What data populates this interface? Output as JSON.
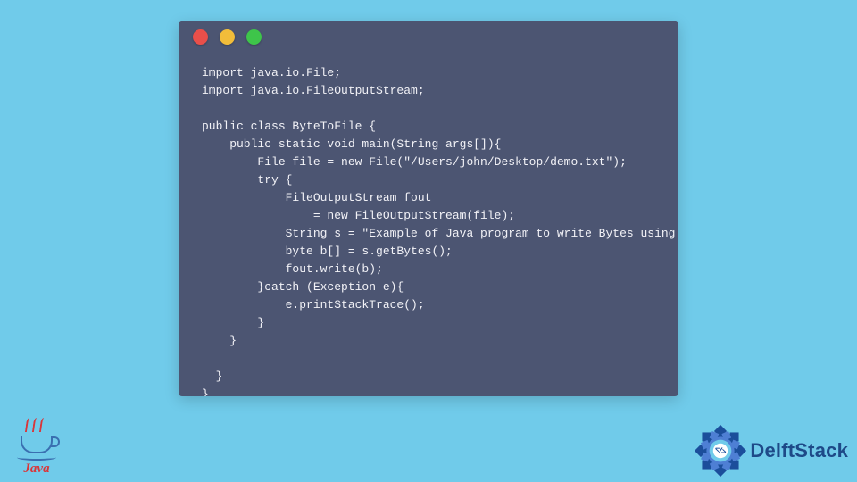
{
  "colors": {
    "page_bg": "#70CBEA",
    "window_bg": "#4C5572",
    "titlebar_bg": "#4C5572",
    "code_text": "#F2F2F7",
    "dot_red": "#E94F4A",
    "dot_yellow": "#F2BD3A",
    "dot_green": "#3EC54A",
    "java_red": "#D9363A",
    "java_blue": "#3A6FB0",
    "delft_gear1": "#1B4E9B",
    "delft_gear2": "#4E7FD4",
    "delft_core": "#FFFFFF",
    "delft_text": "#1E4A88"
  },
  "code": {
    "lines": [
      "import java.io.File;",
      "import java.io.FileOutputStream;",
      "",
      "public class ByteToFile {",
      "    public static void main(String args[]){",
      "        File file = new File(\"/Users/john/Desktop/demo.txt\");",
      "        try {",
      "            FileOutputStream fout",
      "                = new FileOutputStream(file);",
      "            String s = \"Example of Java program to write Bytes using ByteStream.\";",
      "            byte b[] = s.getBytes();",
      "            fout.write(b);",
      "        }catch (Exception e){",
      "            e.printStackTrace();",
      "        }",
      "    }",
      "",
      "  }",
      "}"
    ]
  },
  "java_logo": {
    "label": "Java"
  },
  "delftstack": {
    "label": "DelftStack",
    "core_glyph": "</>"
  }
}
